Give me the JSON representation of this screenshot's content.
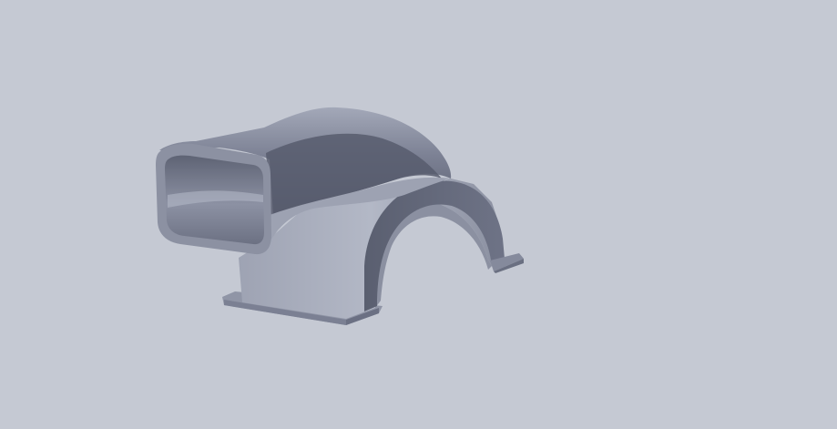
{
  "viewport": {
    "background_color": "#c5c9d3"
  },
  "model": {
    "kind": "3d-shaded-part",
    "description_visible": false,
    "colors": {
      "base": "#8a8fa2",
      "light": "#b4b9c8",
      "mid": "#7b8094",
      "dark": "#565b6c",
      "darkest": "#42475a"
    }
  }
}
